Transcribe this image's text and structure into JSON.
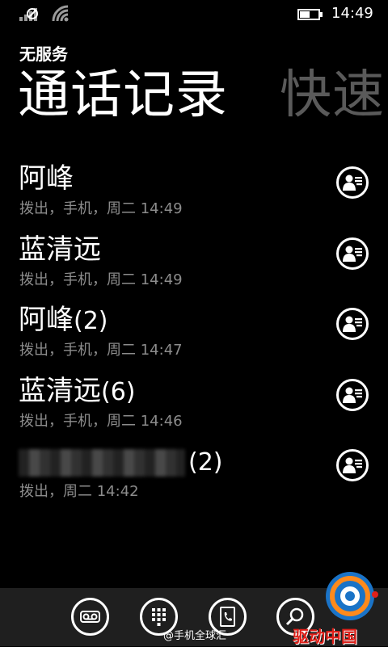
{
  "status_bar": {
    "time": "14:49",
    "icons": [
      "no-sim-signal-icon",
      "wifi-icon",
      "battery-icon"
    ]
  },
  "header": {
    "carrier": "无服务",
    "pivot_active": "通话记录",
    "pivot_next": "快速"
  },
  "calls": [
    {
      "name": "阿峰",
      "count": "",
      "detail": "拨出，手机，周二 14:49",
      "icon": "contact-card-icon"
    },
    {
      "name": "蓝清远",
      "count": "",
      "detail": "拨出，手机，周二 14:49",
      "icon": "contact-card-icon"
    },
    {
      "name": "阿峰",
      "count": "(2)",
      "detail": "拨出，手机，周二 14:47",
      "icon": "contact-card-icon"
    },
    {
      "name": "蓝清远",
      "count": "(6)",
      "detail": "拨出，手机，周二 14:46",
      "icon": "contact-card-icon"
    },
    {
      "name": "",
      "count": "(2)",
      "detail": "拨出，周二 14:42",
      "icon": "contact-card-icon"
    }
  ],
  "app_bar": {
    "buttons": [
      "voicemail-icon",
      "keypad-icon",
      "phonebook-icon",
      "search-icon"
    ],
    "watermark": "@手机全球汇",
    "logo_text": "驱动中国"
  },
  "colors": {
    "background": "#000000",
    "text": "#ffffff",
    "secondary_text": "#8c8c8c",
    "app_bar": "#1f1f1f",
    "logo_red": "#e0201a",
    "logo_blue": "#1a73c7"
  }
}
